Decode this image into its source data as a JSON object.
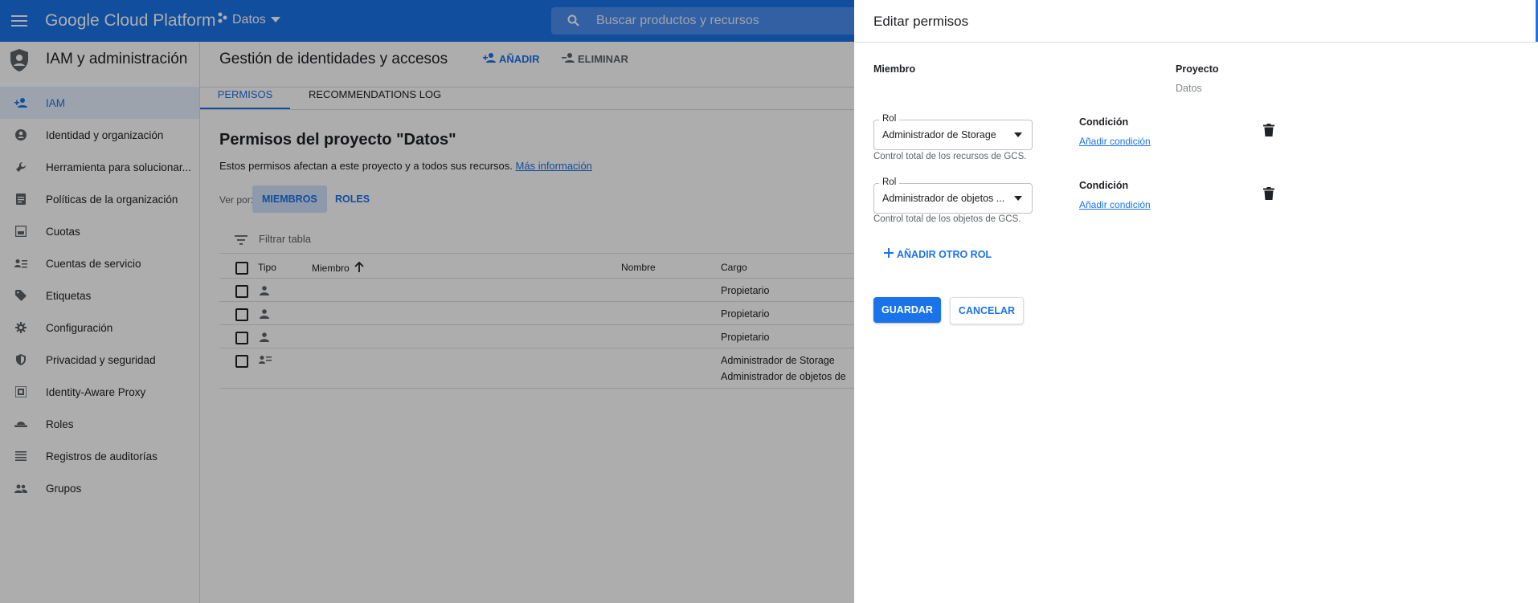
{
  "topbar": {
    "logo": "Google Cloud Platform",
    "project": "Datos",
    "search_placeholder": "Buscar productos y recursos"
  },
  "sidebar": {
    "title": "IAM y administración",
    "items": [
      {
        "label": "IAM",
        "icon": "person-add-icon",
        "active": true
      },
      {
        "label": "Identidad y organización",
        "icon": "account-circle-icon"
      },
      {
        "label": "Herramienta para solucionar...",
        "icon": "wrench-icon"
      },
      {
        "label": "Políticas de la organización",
        "icon": "document-icon"
      },
      {
        "label": "Cuotas",
        "icon": "quota-icon"
      },
      {
        "label": "Cuentas de servicio",
        "icon": "service-account-icon"
      },
      {
        "label": "Etiquetas",
        "icon": "tag-icon"
      },
      {
        "label": "Configuración",
        "icon": "gear-icon"
      },
      {
        "label": "Privacidad y seguridad",
        "icon": "shield-icon"
      },
      {
        "label": "Identity-Aware Proxy",
        "icon": "proxy-icon"
      },
      {
        "label": "Roles",
        "icon": "hat-icon"
      },
      {
        "label": "Registros de auditorías",
        "icon": "list-icon"
      },
      {
        "label": "Grupos",
        "icon": "group-icon"
      }
    ]
  },
  "header": {
    "title": "Gestión de identidades y accesos",
    "add_label": "AÑADIR",
    "remove_label": "ELIMINAR"
  },
  "tabs": [
    "PERMISOS",
    "RECOMMENDATIONS LOG"
  ],
  "permissions": {
    "title": "Permisos del proyecto \"Datos\"",
    "description": "Estos permisos afectan a este proyecto y a todos sus recursos.",
    "more_info": "Más información",
    "view_by": "Ver por:",
    "view_members": "MIEMBROS",
    "view_roles": "ROLES",
    "filter_placeholder": "Filtrar tabla",
    "columns": {
      "type": "Tipo",
      "member": "Miembro",
      "name": "Nombre",
      "role": "Cargo"
    },
    "rows": [
      {
        "type_icon": "person-icon",
        "roles": [
          "Propietario"
        ]
      },
      {
        "type_icon": "person-icon",
        "roles": [
          "Propietario"
        ]
      },
      {
        "type_icon": "person-icon",
        "roles": [
          "Propietario"
        ]
      },
      {
        "type_icon": "service-account-icon",
        "roles": [
          "Administrador de Storage",
          "Administrador de objetos de"
        ]
      }
    ]
  },
  "panel": {
    "title": "Editar permisos",
    "member_label": "Miembro",
    "project_label": "Proyecto",
    "project_value": "Datos",
    "roles": [
      {
        "legend": "Rol",
        "value": "Administrador de Storage",
        "hint": "Control total de los recursos de GCS.",
        "condition_label": "Condición",
        "condition_link": "Añadir condición"
      },
      {
        "legend": "Rol",
        "value": "Administrador de objetos ...",
        "hint": "Control total de los objetos de GCS.",
        "condition_label": "Condición",
        "condition_link": "Añadir condición"
      }
    ],
    "add_role": "AÑADIR OTRO ROL",
    "save": "GUARDAR",
    "cancel": "CANCELAR"
  },
  "colors": {
    "accent": "#1a73e8",
    "overlay": "rgba(0,0,0,0.32)"
  }
}
